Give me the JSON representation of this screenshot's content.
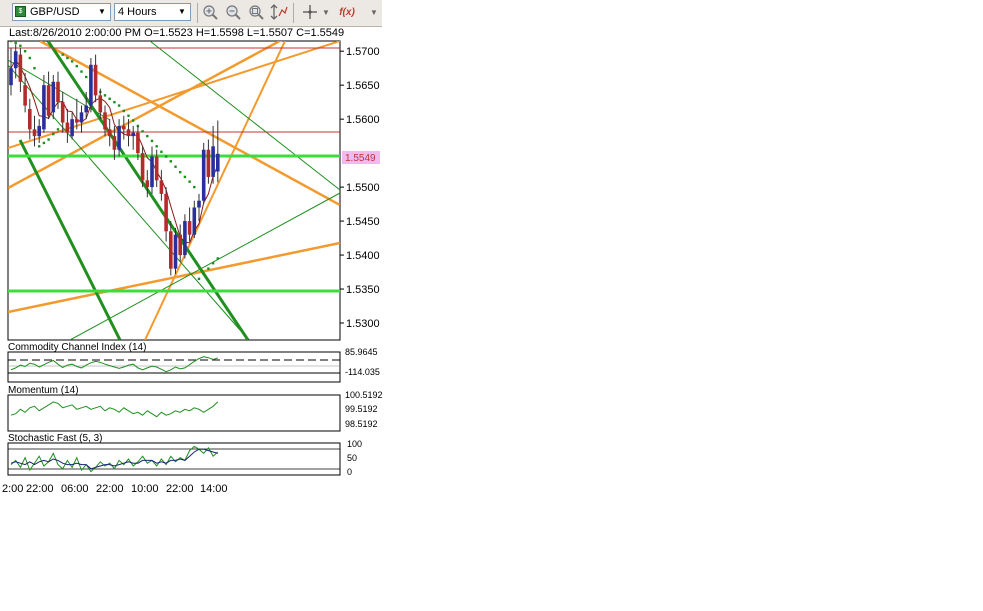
{
  "toolbar": {
    "symbol": "GBP/USD",
    "interval": "4 Hours",
    "buttons": [
      "zoom-in",
      "zoom-out",
      "zoom-fit",
      "scale",
      "crosshair",
      "functions"
    ],
    "functions_label": "f(x)"
  },
  "info": {
    "text": "Last:8/26/2010 2:00:00 PM O=1.5523 H=1.5598 L=1.5507 C=1.5549"
  },
  "colors": {
    "bull": "#2b2f9e",
    "bear": "#b52a2a",
    "psar": "#1a8f1a",
    "orange": "#f39a2e",
    "green_line": "#1f8f1f",
    "ma": "#8b1a1a",
    "hline_green": "#3ddc3d",
    "hline_red": "#c23434",
    "last_bg": "#f0b9f0"
  },
  "chart_data": [
    {
      "type": "candlestick",
      "title": "GBP/USD 4 Hours",
      "ylim": [
        1.5275,
        1.5715
      ],
      "y_ticks": [
        "1.5700",
        "1.5650",
        "1.5600",
        "1.5500",
        "1.5450",
        "1.5400",
        "1.5350",
        "1.5300"
      ],
      "last_price": "1.5549",
      "horizontal_levels": {
        "green": [
          1.5555,
          1.5355
        ],
        "red": [
          1.5706,
          1.5589
        ]
      },
      "candles": [
        [
          1.565,
          1.5705,
          1.5635,
          1.5675
        ],
        [
          1.5675,
          1.571,
          1.566,
          1.57
        ],
        [
          1.5695,
          1.5705,
          1.564,
          1.5655
        ],
        [
          1.565,
          1.5668,
          1.561,
          1.562
        ],
        [
          1.5615,
          1.563,
          1.557,
          1.5585
        ],
        [
          1.5585,
          1.5605,
          1.556,
          1.5575
        ],
        [
          1.5575,
          1.56,
          1.5565,
          1.559
        ],
        [
          1.5585,
          1.5665,
          1.558,
          1.565
        ],
        [
          1.565,
          1.567,
          1.56,
          1.5605
        ],
        [
          1.561,
          1.5665,
          1.56,
          1.5655
        ],
        [
          1.5655,
          1.567,
          1.5615,
          1.5625
        ],
        [
          1.5625,
          1.564,
          1.558,
          1.5595
        ],
        [
          1.5595,
          1.5615,
          1.5565,
          1.558
        ],
        [
          1.5575,
          1.561,
          1.557,
          1.56
        ],
        [
          1.56,
          1.563,
          1.5585,
          1.5595
        ],
        [
          1.5595,
          1.562,
          1.558,
          1.561
        ],
        [
          1.561,
          1.564,
          1.56,
          1.562
        ],
        [
          1.562,
          1.569,
          1.561,
          1.568
        ],
        [
          1.568,
          1.5695,
          1.5625,
          1.5635
        ],
        [
          1.5635,
          1.5645,
          1.56,
          1.561
        ],
        [
          1.561,
          1.562,
          1.5575,
          1.5585
        ],
        [
          1.5585,
          1.56,
          1.556,
          1.5575
        ],
        [
          1.5575,
          1.559,
          1.554,
          1.5555
        ],
        [
          1.5555,
          1.56,
          1.5545,
          1.559
        ],
        [
          1.559,
          1.5605,
          1.557,
          1.5585
        ],
        [
          1.5585,
          1.56,
          1.556,
          1.5575
        ],
        [
          1.5575,
          1.559,
          1.5555,
          1.558
        ],
        [
          1.558,
          1.559,
          1.554,
          1.555
        ],
        [
          1.555,
          1.556,
          1.55,
          1.551
        ],
        [
          1.551,
          1.5525,
          1.5485,
          1.55
        ],
        [
          1.55,
          1.556,
          1.549,
          1.5545
        ],
        [
          1.5545,
          1.5555,
          1.55,
          1.551
        ],
        [
          1.551,
          1.5525,
          1.548,
          1.549
        ],
        [
          1.549,
          1.55,
          1.542,
          1.5435
        ],
        [
          1.5435,
          1.545,
          1.537,
          1.538
        ],
        [
          1.538,
          1.544,
          1.5372,
          1.543
        ],
        [
          1.543,
          1.5445,
          1.539,
          1.54
        ],
        [
          1.54,
          1.546,
          1.5395,
          1.545
        ],
        [
          1.545,
          1.547,
          1.542,
          1.543
        ],
        [
          1.543,
          1.548,
          1.5425,
          1.547
        ],
        [
          1.547,
          1.549,
          1.545,
          1.548
        ],
        [
          1.548,
          1.5565,
          1.5475,
          1.5555
        ],
        [
          1.5555,
          1.557,
          1.5505,
          1.5515
        ],
        [
          1.5515,
          1.559,
          1.5505,
          1.556
        ],
        [
          1.5523,
          1.5598,
          1.5507,
          1.5549
        ]
      ],
      "psar": [
        1.5715,
        1.5712,
        1.5708,
        1.57,
        1.569,
        1.5675,
        1.556,
        1.5565,
        1.557,
        1.5578,
        1.5585,
        1.5695,
        1.569,
        1.5685,
        1.5678,
        1.567,
        1.5662,
        1.5655,
        1.5648,
        1.564,
        1.5635,
        1.563,
        1.5625,
        1.562,
        1.5612,
        1.5605,
        1.5598,
        1.559,
        1.5582,
        1.5575,
        1.5568,
        1.556,
        1.5552,
        1.5545,
        1.5538,
        1.553,
        1.5522,
        1.5515,
        1.5508,
        1.55,
        1.5365,
        1.5372,
        1.538,
        1.5388,
        1.5395
      ]
    },
    {
      "type": "line",
      "title": "Commodity Channel Index (14)",
      "y_ticks": [
        "85.9645",
        "-114.035"
      ],
      "levels": [
        100,
        0,
        -100
      ],
      "ylim": [
        -160,
        140
      ],
      "values": [
        -40,
        -20,
        10,
        -5,
        30,
        20,
        -10,
        15,
        40,
        60,
        20,
        -15,
        10,
        20,
        -5,
        -20,
        10,
        35,
        50,
        40,
        20,
        5,
        -10,
        -25,
        -10,
        10,
        20,
        -20,
        -40,
        -20,
        0,
        -10,
        -35,
        -60,
        -40,
        -10,
        -30,
        -20,
        15,
        50,
        80,
        100,
        90,
        70,
        86
      ]
    },
    {
      "type": "line",
      "title": "Momentum (14)",
      "y_ticks": [
        "100.5192",
        "99.5192",
        "98.5192"
      ],
      "ylim": [
        98.4,
        100.7
      ],
      "values": [
        99.4,
        99.5,
        99.8,
        99.6,
        99.9,
        100.0,
        99.7,
        99.9,
        100.1,
        100.3,
        100.2,
        99.9,
        100.0,
        100.1,
        99.8,
        99.9,
        100.0,
        99.8,
        99.9,
        100.0,
        99.7,
        99.9,
        99.8,
        99.6,
        99.9,
        99.7,
        99.5,
        99.6,
        99.4,
        99.7,
        99.5,
        99.3,
        99.6,
        99.4,
        99.5,
        99.7,
        99.6,
        99.8,
        99.7,
        99.9,
        99.8,
        99.6,
        99.8,
        100.0,
        100.3
      ]
    },
    {
      "type": "line",
      "title": "Stochastic Fast (5, 3)",
      "y_ticks": [
        "100",
        "50",
        "0"
      ],
      "ylim": [
        0,
        100
      ],
      "levels": [
        80,
        20
      ],
      "series": [
        {
          "values": [
            30,
            45,
            20,
            55,
            10,
            35,
            60,
            25,
            40,
            70,
            30,
            15,
            45,
            20,
            55,
            10,
            30,
            5,
            20,
            40,
            25,
            35,
            15,
            45,
            30,
            50,
            25,
            40,
            60,
            35,
            45,
            25,
            50,
            30,
            60,
            40,
            55,
            45,
            80,
            95,
            85,
            70,
            90,
            60,
            75
          ]
        },
        {
          "values": [
            35,
            40,
            35,
            30,
            40,
            30,
            40,
            45,
            40,
            50,
            45,
            35,
            30,
            30,
            35,
            30,
            30,
            15,
            20,
            25,
            30,
            30,
            25,
            30,
            35,
            40,
            35,
            35,
            45,
            45,
            45,
            35,
            40,
            35,
            45,
            45,
            50,
            45,
            60,
            75,
            85,
            85,
            80,
            75,
            70
          ]
        }
      ]
    }
  ],
  "x_axis": {
    "labels": [
      "2:00",
      "22:00",
      "06:00",
      "22:00",
      "10:00",
      "22:00",
      "14:00"
    ]
  }
}
